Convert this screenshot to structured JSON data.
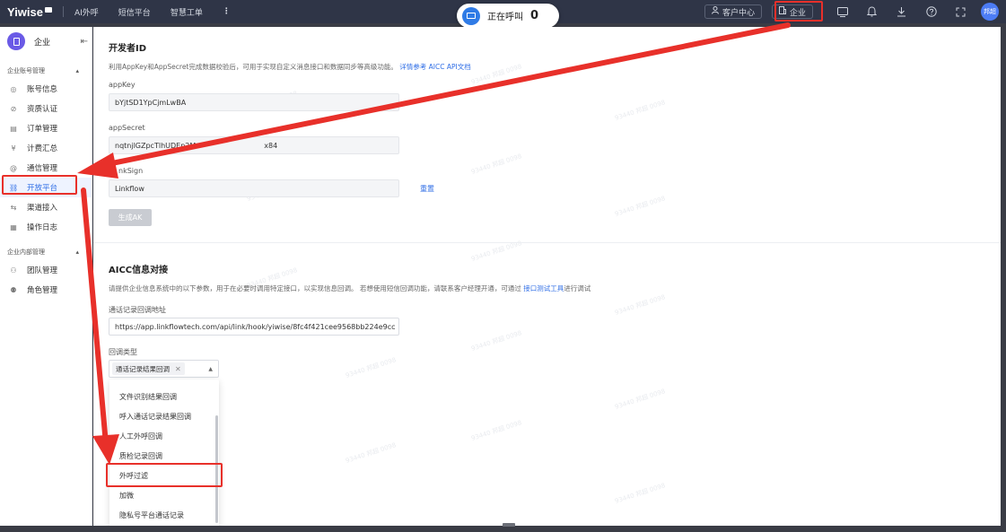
{
  "topbar": {
    "logo": "Yiwise",
    "nav": [
      "AI外呼",
      "短信平台",
      "智慧工单"
    ],
    "more": "⋮",
    "calling_label": "正在呼叫",
    "calling_count": "0",
    "customer_center": "客户中心",
    "enterprise": "企业",
    "avatar_text": "邦超"
  },
  "sidebar": {
    "title": "企业",
    "groups": [
      {
        "label": "企业账号管理",
        "items": [
          {
            "label": "账号信息",
            "icon": "user-circle-icon"
          },
          {
            "label": "资质认证",
            "icon": "badge-icon"
          },
          {
            "label": "订单管理",
            "icon": "list-icon"
          },
          {
            "label": "计费汇总",
            "icon": "yen-icon"
          },
          {
            "label": "通信管理",
            "icon": "at-icon"
          },
          {
            "label": "开放平台",
            "icon": "link-icon",
            "active": true
          },
          {
            "label": "渠道接入",
            "icon": "connect-icon"
          },
          {
            "label": "操作日志",
            "icon": "log-icon"
          }
        ]
      },
      {
        "label": "企业内部管理",
        "items": [
          {
            "label": "团队管理",
            "icon": "team-icon"
          },
          {
            "label": "角色管理",
            "icon": "role-icon"
          }
        ]
      }
    ]
  },
  "developer": {
    "title": "开发者ID",
    "desc": "利用AppKey和AppSecret完成数据校验后，可用于实现自定义消息接口和数据同步等高级功能。",
    "desc_link": "详情参考 AICC API文档",
    "appkey_label": "appKey",
    "appkey_value": "bYjtSD1YpCjmLwBA",
    "appsecret_label": "appSecret",
    "appsecret_value": "nqtnjlGZpcTlhUDEp2M",
    "appsecret_tail": "x84",
    "sign_label": "nkSign",
    "sign_value": "Linkflow",
    "reset": "重置",
    "generate": "生成AK"
  },
  "aicc": {
    "title": "AICC信息对接",
    "desc": "请提供企业信息系统中的以下参数，用于在必要时调用特定接口，以实现信息回调。 若想使用短信回调功能，请联系客户经理开通，可通过",
    "desc_link": "接口测试工具",
    "desc_tail": "进行调试",
    "callback_label": "通话记录回调地址",
    "callback_value": "https://app.linkflowtech.com/api/link/hook/yiwise/8fc4f421cee9568bb224e9cc",
    "type_label": "回调类型",
    "selected_tag": "通话记录结果回调",
    "options": [
      "文件识别结果回调",
      "呼入通话记录结果回调",
      "人工外呼回调",
      "质检记录回调",
      "外呼过滤",
      "加微",
      "隐私号平台通话记录"
    ]
  },
  "watermark": "93440 邦超 0098",
  "colors": {
    "accent": "#2f6ee6",
    "annotation": "#e8302a",
    "topbar": "#2f3547"
  }
}
